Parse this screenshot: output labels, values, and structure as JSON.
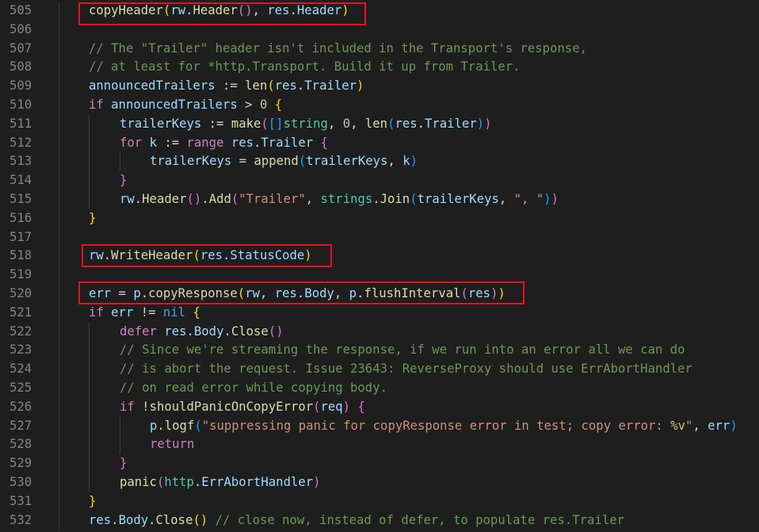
{
  "editor": {
    "lines": [
      {
        "n": "505",
        "indent": 1,
        "tokens": [
          [
            "copyHeader",
            "fn"
          ],
          [
            "(",
            "b1"
          ],
          [
            "rw",
            "var"
          ],
          [
            ".",
            "pun"
          ],
          [
            "Header",
            "fn"
          ],
          [
            "(",
            "b2"
          ],
          [
            ")",
            "b2"
          ],
          [
            ", ",
            "pun"
          ],
          [
            "res",
            "var"
          ],
          [
            ".",
            "pun"
          ],
          [
            "Header",
            "var"
          ],
          [
            ")",
            "b1"
          ]
        ]
      },
      {
        "n": "506",
        "indent": 1,
        "tokens": []
      },
      {
        "n": "507",
        "indent": 1,
        "tokens": [
          [
            "// The \"Trailer\" header isn't included in the Transport's response,",
            "com"
          ]
        ]
      },
      {
        "n": "508",
        "indent": 1,
        "tokens": [
          [
            "// at least for *http.Transport. Build it up from Trailer.",
            "com"
          ]
        ]
      },
      {
        "n": "509",
        "indent": 1,
        "tokens": [
          [
            "announcedTrailers",
            "var"
          ],
          [
            " := ",
            "op"
          ],
          [
            "len",
            "fn"
          ],
          [
            "(",
            "b1"
          ],
          [
            "res",
            "var"
          ],
          [
            ".",
            "pun"
          ],
          [
            "Trailer",
            "var"
          ],
          [
            ")",
            "b1"
          ]
        ]
      },
      {
        "n": "510",
        "indent": 1,
        "tokens": [
          [
            "if",
            "ctl"
          ],
          [
            " ",
            "pun"
          ],
          [
            "announcedTrailers",
            "var"
          ],
          [
            " > ",
            "op"
          ],
          [
            "0",
            "num"
          ],
          [
            " ",
            "pun"
          ],
          [
            "{",
            "b1"
          ]
        ]
      },
      {
        "n": "511",
        "indent": 2,
        "tokens": [
          [
            "trailerKeys",
            "var"
          ],
          [
            " := ",
            "op"
          ],
          [
            "make",
            "fn"
          ],
          [
            "(",
            "b2"
          ],
          [
            "[]",
            "b3"
          ],
          [
            "string",
            "type"
          ],
          [
            ", ",
            "pun"
          ],
          [
            "0",
            "num"
          ],
          [
            ", ",
            "pun"
          ],
          [
            "len",
            "fn"
          ],
          [
            "(",
            "b3"
          ],
          [
            "res",
            "var"
          ],
          [
            ".",
            "pun"
          ],
          [
            "Trailer",
            "var"
          ],
          [
            ")",
            "b3"
          ],
          [
            ")",
            "b2"
          ]
        ]
      },
      {
        "n": "512",
        "indent": 2,
        "tokens": [
          [
            "for",
            "ctl"
          ],
          [
            " ",
            "pun"
          ],
          [
            "k",
            "var"
          ],
          [
            " := ",
            "op"
          ],
          [
            "range",
            "ctl"
          ],
          [
            " ",
            "pun"
          ],
          [
            "res",
            "var"
          ],
          [
            ".",
            "pun"
          ],
          [
            "Trailer",
            "var"
          ],
          [
            " ",
            "pun"
          ],
          [
            "{",
            "b2"
          ]
        ]
      },
      {
        "n": "513",
        "indent": 3,
        "tokens": [
          [
            "trailerKeys",
            "var"
          ],
          [
            " = ",
            "op"
          ],
          [
            "append",
            "fn"
          ],
          [
            "(",
            "b3"
          ],
          [
            "trailerKeys",
            "var"
          ],
          [
            ", ",
            "pun"
          ],
          [
            "k",
            "var"
          ],
          [
            ")",
            "b3"
          ]
        ]
      },
      {
        "n": "514",
        "indent": 2,
        "tokens": [
          [
            "}",
            "b2"
          ]
        ]
      },
      {
        "n": "515",
        "indent": 2,
        "tokens": [
          [
            "rw",
            "var"
          ],
          [
            ".",
            "pun"
          ],
          [
            "Header",
            "fn"
          ],
          [
            "(",
            "b2"
          ],
          [
            ")",
            "b2"
          ],
          [
            ".",
            "pun"
          ],
          [
            "Add",
            "fn"
          ],
          [
            "(",
            "b2"
          ],
          [
            "\"Trailer\"",
            "str"
          ],
          [
            ", ",
            "pun"
          ],
          [
            "strings",
            "type"
          ],
          [
            ".",
            "pun"
          ],
          [
            "Join",
            "fn"
          ],
          [
            "(",
            "b3"
          ],
          [
            "trailerKeys",
            "var"
          ],
          [
            ", ",
            "pun"
          ],
          [
            "\", \"",
            "str"
          ],
          [
            ")",
            "b3"
          ],
          [
            ")",
            "b2"
          ]
        ]
      },
      {
        "n": "516",
        "indent": 1,
        "tokens": [
          [
            "}",
            "b1"
          ]
        ]
      },
      {
        "n": "517",
        "indent": 1,
        "tokens": []
      },
      {
        "n": "518",
        "indent": 1,
        "tokens": [
          [
            "rw",
            "var"
          ],
          [
            ".",
            "pun"
          ],
          [
            "WriteHeader",
            "fn"
          ],
          [
            "(",
            "b1"
          ],
          [
            "res",
            "var"
          ],
          [
            ".",
            "pun"
          ],
          [
            "StatusCode",
            "var"
          ],
          [
            ")",
            "b1"
          ]
        ]
      },
      {
        "n": "519",
        "indent": 1,
        "tokens": []
      },
      {
        "n": "520",
        "indent": 1,
        "tokens": [
          [
            "err",
            "var"
          ],
          [
            " = ",
            "op"
          ],
          [
            "p",
            "var"
          ],
          [
            ".",
            "pun"
          ],
          [
            "copyResponse",
            "fn"
          ],
          [
            "(",
            "b1"
          ],
          [
            "rw",
            "var"
          ],
          [
            ", ",
            "pun"
          ],
          [
            "res",
            "var"
          ],
          [
            ".",
            "pun"
          ],
          [
            "Body",
            "var"
          ],
          [
            ", ",
            "pun"
          ],
          [
            "p",
            "var"
          ],
          [
            ".",
            "pun"
          ],
          [
            "flushInterval",
            "fn"
          ],
          [
            "(",
            "b2"
          ],
          [
            "res",
            "var"
          ],
          [
            ")",
            "b2"
          ],
          [
            ")",
            "b1"
          ]
        ]
      },
      {
        "n": "521",
        "indent": 1,
        "tokens": [
          [
            "if",
            "ctl"
          ],
          [
            " ",
            "pun"
          ],
          [
            "err",
            "var"
          ],
          [
            " != ",
            "op"
          ],
          [
            "nil",
            "kw"
          ],
          [
            " ",
            "pun"
          ],
          [
            "{",
            "b1"
          ]
        ]
      },
      {
        "n": "522",
        "indent": 2,
        "tokens": [
          [
            "defer",
            "ctl"
          ],
          [
            " ",
            "pun"
          ],
          [
            "res",
            "var"
          ],
          [
            ".",
            "pun"
          ],
          [
            "Body",
            "var"
          ],
          [
            ".",
            "pun"
          ],
          [
            "Close",
            "fn"
          ],
          [
            "()",
            "b2"
          ]
        ]
      },
      {
        "n": "523",
        "indent": 2,
        "tokens": [
          [
            "// Since we're streaming the response, if we run into an error all we can do",
            "com"
          ]
        ]
      },
      {
        "n": "524",
        "indent": 2,
        "tokens": [
          [
            "// is abort the request. Issue 23643: ReverseProxy should use ErrAbortHandler",
            "com"
          ]
        ]
      },
      {
        "n": "525",
        "indent": 2,
        "tokens": [
          [
            "// on read error while copying body.",
            "com"
          ]
        ]
      },
      {
        "n": "526",
        "indent": 2,
        "tokens": [
          [
            "if",
            "ctl"
          ],
          [
            " !",
            "op"
          ],
          [
            "shouldPanicOnCopyError",
            "fn"
          ],
          [
            "(",
            "b2"
          ],
          [
            "req",
            "var"
          ],
          [
            ")",
            "b2"
          ],
          [
            " ",
            "pun"
          ],
          [
            "{",
            "b2"
          ]
        ]
      },
      {
        "n": "527",
        "indent": 3,
        "tokens": [
          [
            "p",
            "var"
          ],
          [
            ".",
            "pun"
          ],
          [
            "logf",
            "fn"
          ],
          [
            "(",
            "b3"
          ],
          [
            "\"suppressing panic for copyResponse error in test; copy error: ",
            "str"
          ],
          [
            "%v",
            "esc"
          ],
          [
            "\"",
            "str"
          ],
          [
            ", ",
            "pun"
          ],
          [
            "err",
            "var"
          ],
          [
            ")",
            "b3"
          ]
        ]
      },
      {
        "n": "528",
        "indent": 3,
        "tokens": [
          [
            "return",
            "ctl"
          ]
        ]
      },
      {
        "n": "529",
        "indent": 2,
        "tokens": [
          [
            "}",
            "b2"
          ]
        ]
      },
      {
        "n": "530",
        "indent": 2,
        "tokens": [
          [
            "panic",
            "fn"
          ],
          [
            "(",
            "b2"
          ],
          [
            "http",
            "type"
          ],
          [
            ".",
            "pun"
          ],
          [
            "ErrAbortHandler",
            "var"
          ],
          [
            ")",
            "b2"
          ]
        ]
      },
      {
        "n": "531",
        "indent": 1,
        "tokens": [
          [
            "}",
            "b1"
          ]
        ]
      },
      {
        "n": "532",
        "indent": 1,
        "tokens": [
          [
            "res",
            "var"
          ],
          [
            ".",
            "pun"
          ],
          [
            "Body",
            "var"
          ],
          [
            ".",
            "pun"
          ],
          [
            "Close",
            "fn"
          ],
          [
            "()",
            "b1"
          ],
          [
            " ",
            "pun"
          ],
          [
            "// close now, instead of defer, to populate res.Trailer",
            "com"
          ]
        ]
      }
    ],
    "highlights": [
      {
        "line": "505",
        "label": "copyHeader call"
      },
      {
        "line": "518",
        "label": "WriteHeader call"
      },
      {
        "line": "520",
        "label": "copyResponse call"
      }
    ],
    "colors": {
      "background": "#1e1e1e",
      "line_number": "#858585",
      "highlight_box": "#e81123"
    }
  }
}
